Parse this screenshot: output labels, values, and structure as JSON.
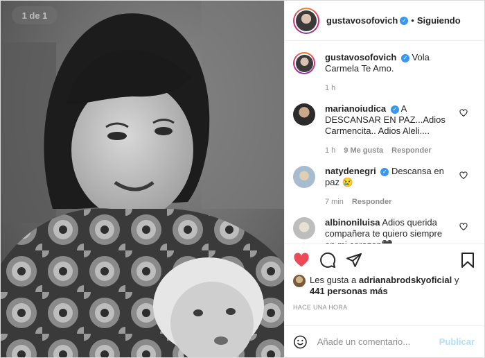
{
  "photo": {
    "counter": "1 de 1"
  },
  "header": {
    "username": "gustavosofovich",
    "separator": "•",
    "follow_label": "Siguiendo"
  },
  "caption": {
    "username": "gustavosofovich",
    "text": "Vola Carmela Te Amo.",
    "time": "1 h"
  },
  "comments": [
    {
      "username": "marianoiudica",
      "verified": true,
      "text": "A DESCANSAR EN PAZ...Adios Carmencita.. Adios Aleli....",
      "time": "1 h",
      "likes": "9 Me gusta",
      "reply": "Responder"
    },
    {
      "username": "natydenegri",
      "verified": true,
      "text": "Descansa en paz 😢",
      "time": "7 min",
      "likes": "",
      "reply": "Responder"
    },
    {
      "username": "albinoniluisa",
      "verified": false,
      "text": "Adios querida compañera te quiero siempre en mi corazon🖤",
      "time": "",
      "likes": "",
      "reply": ""
    }
  ],
  "likes": {
    "prefix": "Les gusta a",
    "user": "adrianabrodskyoficial",
    "suffix": "y",
    "count": "441 personas más"
  },
  "posted_ago": "HACE UNA HORA",
  "composer": {
    "placeholder": "Añade un comentario...",
    "publish_label": "Publicar"
  },
  "colors": {
    "like_red": "#ed4956",
    "verified_blue": "#3897f0",
    "publish_disabled": "#b2dffc"
  },
  "icons": [
    "heart-filled-icon",
    "comment-icon",
    "share-icon",
    "bookmark-icon",
    "emoji-icon",
    "verified-icon",
    "heart-outline-icon"
  ]
}
